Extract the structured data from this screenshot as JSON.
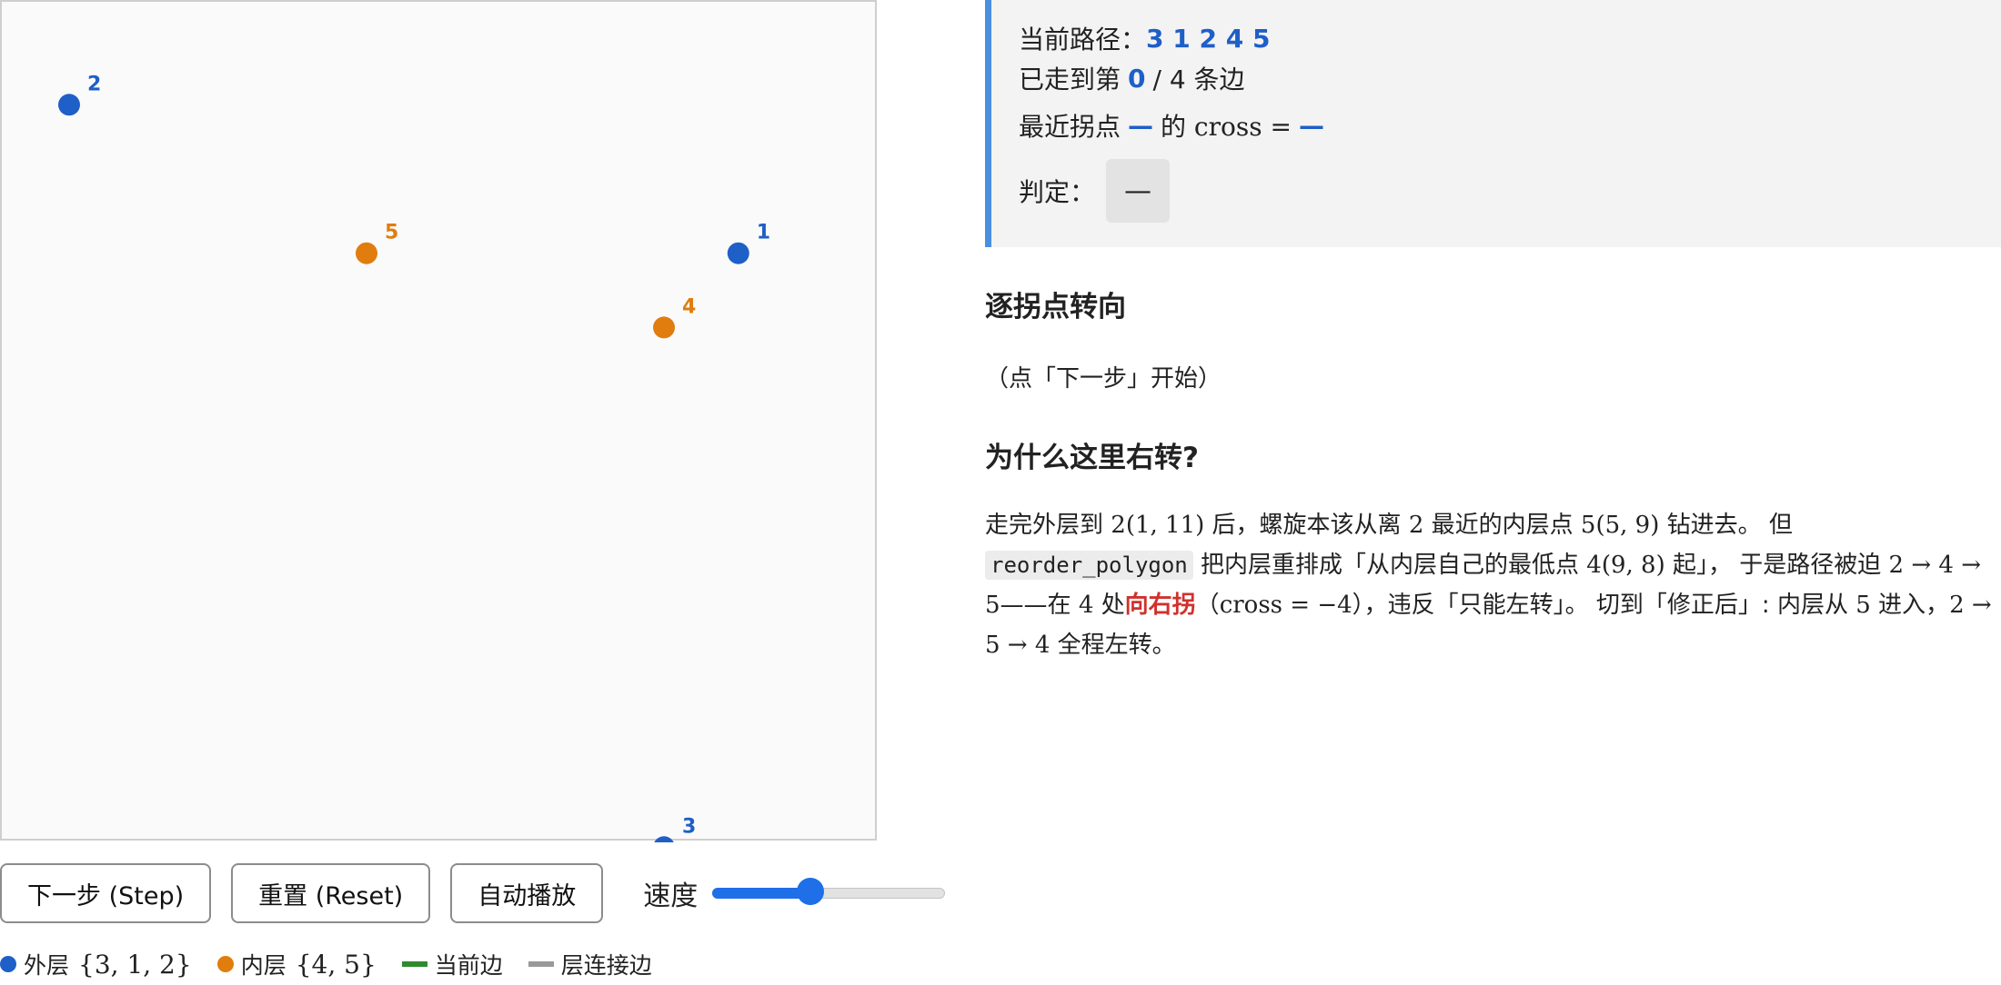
{
  "canvas": {
    "points": [
      {
        "id": "1",
        "layer": "outer",
        "x": 10,
        "y": 9
      },
      {
        "id": "2",
        "layer": "outer",
        "x": 1,
        "y": 11
      },
      {
        "id": "3",
        "layer": "outer",
        "x": 9,
        "y": 1
      },
      {
        "id": "4",
        "layer": "inner",
        "x": 9,
        "y": 8
      },
      {
        "id": "5",
        "layer": "inner",
        "x": 5,
        "y": 9
      }
    ],
    "colors": {
      "outer": "#1e5fc8",
      "inner": "#e07d0e",
      "current_edge": "#2e8b2e",
      "layer_edge": "#999999"
    }
  },
  "controls": {
    "step_label": "下一步 (Step)",
    "reset_label": "重置 (Reset)",
    "autoplay_label": "自动播放",
    "speed_label": "速度",
    "speed_value": 0.42
  },
  "legend": {
    "outer_label": "外层",
    "outer_set": "{3, 1, 2}",
    "inner_label": "内层",
    "inner_set": "{4, 5}",
    "current_edge_label": "当前边",
    "layer_edge_label": "层连接边"
  },
  "status": {
    "path_label": "当前路径：",
    "path_value": "3 1 2 4 5",
    "progress_prefix": "已走到第",
    "progress_value": "0",
    "progress_suffix": "/ 4 条边",
    "turn_prefix": "最近拐点",
    "turn_point": "—",
    "turn_mid": "的 cross =",
    "turn_cross": "—",
    "verdict_label": "判定：",
    "verdict_value": "—"
  },
  "section_turns": {
    "title": "逐拐点转向",
    "hint": "（点「下一步」开始）"
  },
  "section_why": {
    "title": "为什么这里右转?",
    "p1": "走完外层到",
    "m1": "2(1, 11)",
    "p2": "后，螺旋本该从离",
    "m2": "2",
    "p3": "最近的内层点",
    "m3": "5(5, 9)",
    "p4": "钻进去。 但",
    "code": "reorder_polygon",
    "p5": "把内层重排成「从内层自己的最低点",
    "m4": "4(9, 8)",
    "p6": "起」， 于是路径被迫",
    "m5": "2 → 4 → 5",
    "p7": "——在",
    "m6": "4",
    "p8": "处",
    "red": "向右拐",
    "p9": "（",
    "m7": "cross = −4",
    "p10": "），违反「只能左转」。 切到「修正后」: 内层从",
    "m8": "5",
    "p11": "进入，",
    "m9": "2 → 5 → 4",
    "p12": "全程左转。"
  }
}
